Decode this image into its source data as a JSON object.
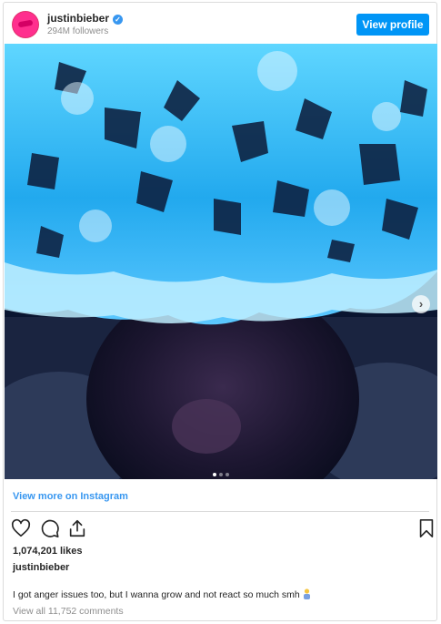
{
  "header": {
    "username": "justinbieber",
    "followers": "294M followers",
    "view_profile_label": "View profile"
  },
  "post": {
    "image_alt": "Close-up of a face under a blue fuzzy hood",
    "carousel_dot_count": 3,
    "carousel_active_index": 0
  },
  "links": {
    "view_more": "View more on Instagram"
  },
  "engagement": {
    "likes": "1,074,201 likes",
    "owner": "justinbieber",
    "caption": "I got anger issues too, but I wanna grow and not react so much smh",
    "caption_emoji": "person-shrugging",
    "comments": "View all 11,752 comments"
  },
  "icons": [
    "heart-icon",
    "comment-icon",
    "share-icon",
    "bookmark-icon",
    "chevron-right-icon",
    "verified-badge-icon"
  ],
  "colors": {
    "accent": "#3897f0",
    "button": "#0095f6",
    "avatar": "#ff2f8e"
  }
}
